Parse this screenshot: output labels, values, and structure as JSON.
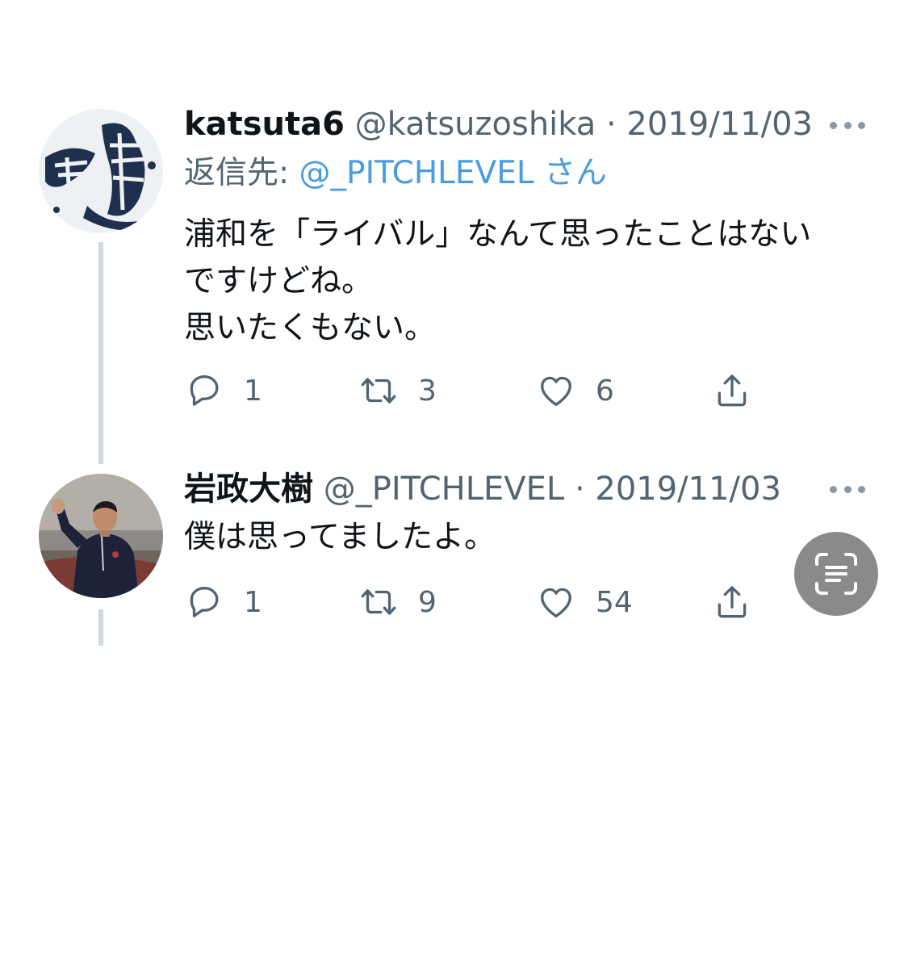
{
  "tweets": [
    {
      "display_name": "katsuta6",
      "handle": "@katsuzoshika",
      "separator": "·",
      "date": "2019/11/03",
      "reply_to_prefix": "返信先: ",
      "reply_to_mention": "@_PITCHLEVEL",
      "reply_to_suffix": "さん",
      "body_lines": [
        "浦和を「ライバル」なんて思ったことはない",
        "ですけどね。",
        "思いたくもない。"
      ],
      "reply_count": "1",
      "retweet_count": "3",
      "like_count": "6",
      "avatar_glyphs": "鹿島"
    },
    {
      "display_name": "岩政大樹",
      "handle": "@_PITCHLEVEL",
      "separator": "·",
      "date": "2019/11/03",
      "body_lines": [
        "僕は思ってましたよ。"
      ],
      "reply_count": "1",
      "retweet_count": "9",
      "like_count": "54"
    }
  ],
  "icons": {
    "more": "more-horizontal-icon",
    "reply": "reply-bubble-icon",
    "retweet": "retweet-arrows-icon",
    "like": "heart-icon",
    "share": "share-upload-icon",
    "scan": "scan-text-icon"
  },
  "colors": {
    "text": "#0f1419",
    "secondary": "#536471",
    "mention": "#4a9ce0",
    "thread_line": "#cfd9de",
    "scan_button": "#8a8a8a"
  }
}
